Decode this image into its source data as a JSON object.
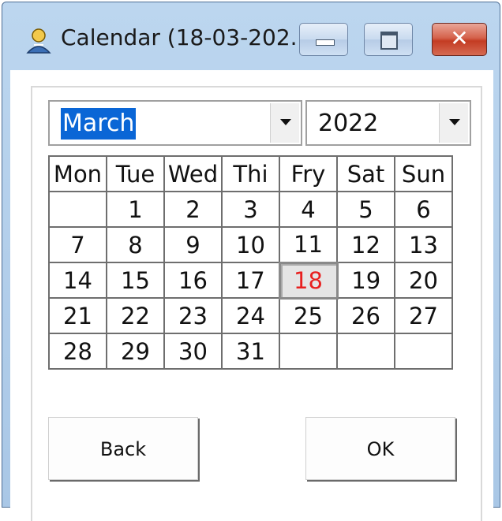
{
  "window": {
    "title": "Calendar (18-03-202...",
    "buttons": [
      "minimize",
      "maximize",
      "close"
    ],
    "close_glyph": "✕"
  },
  "month_combo": {
    "value": "March"
  },
  "year_combo": {
    "value": "2022"
  },
  "calendar": {
    "weekdays": [
      "Mon",
      "Tue",
      "Wed",
      "Thi",
      "Fry",
      "Sat",
      "Sun"
    ],
    "weeks": [
      [
        "",
        "1",
        "2",
        "3",
        "4",
        "5",
        "6"
      ],
      [
        "7",
        "8",
        "9",
        "10",
        "11",
        "12",
        "13"
      ],
      [
        "14",
        "15",
        "16",
        "17",
        "18",
        "19",
        "20"
      ],
      [
        "21",
        "22",
        "23",
        "24",
        "25",
        "26",
        "27"
      ],
      [
        "28",
        "29",
        "30",
        "31",
        "",
        "",
        ""
      ]
    ],
    "selected_day": "18",
    "selected_color": "#e8201f"
  },
  "buttons": {
    "back": "Back",
    "ok": "OK"
  },
  "icons": {
    "app": "user-light-icon"
  }
}
